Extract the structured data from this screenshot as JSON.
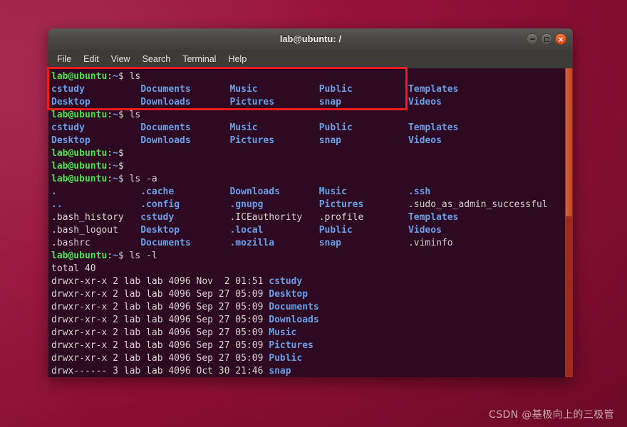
{
  "desktop": {
    "wallpaper_color": "#97113a",
    "watermark": "CSDN @基极向上的三极管"
  },
  "window": {
    "title": "lab@ubuntu: /",
    "controls": {
      "minimize_label": "–",
      "maximize_label": "□",
      "close_label": "×"
    },
    "menu": [
      {
        "label": "File"
      },
      {
        "label": "Edit"
      },
      {
        "label": "View"
      },
      {
        "label": "Search"
      },
      {
        "label": "Terminal"
      },
      {
        "label": "Help"
      }
    ]
  },
  "annotation": {
    "color": "#f01c1c",
    "encloses": "first ls command and its output"
  },
  "terminal": {
    "background_color": "#2d0922",
    "prompt": {
      "user_host": "lab@ubuntu",
      "separator": ":",
      "cwd": "~",
      "sigil": "$",
      "user_color": "#4ee04e",
      "cwd_color": "#6a9fe8",
      "text_color": "#d8d4d0",
      "dir_color": "#6a9fe8"
    },
    "scrollbar": {
      "track_color": "#a32a18",
      "thumb_color": "#c9552c"
    },
    "lines": [
      {
        "type": "prompt",
        "command": "ls"
      },
      {
        "type": "cols",
        "cells": [
          {
            "t": "cstudy",
            "c": "dir"
          },
          {
            "t": "Documents",
            "c": "dir"
          },
          {
            "t": "Music",
            "c": "dir"
          },
          {
            "t": "Public",
            "c": "dir"
          },
          {
            "t": "Templates",
            "c": "dir"
          }
        ]
      },
      {
        "type": "cols",
        "cells": [
          {
            "t": "Desktop",
            "c": "dir"
          },
          {
            "t": "Downloads",
            "c": "dir"
          },
          {
            "t": "Pictures",
            "c": "dir"
          },
          {
            "t": "snap",
            "c": "dir"
          },
          {
            "t": "Videos",
            "c": "dir"
          }
        ]
      },
      {
        "type": "prompt",
        "command": "ls"
      },
      {
        "type": "cols",
        "cells": [
          {
            "t": "cstudy",
            "c": "dir"
          },
          {
            "t": "Documents",
            "c": "dir"
          },
          {
            "t": "Music",
            "c": "dir"
          },
          {
            "t": "Public",
            "c": "dir"
          },
          {
            "t": "Templates",
            "c": "dir"
          }
        ]
      },
      {
        "type": "cols",
        "cells": [
          {
            "t": "Desktop",
            "c": "dir"
          },
          {
            "t": "Downloads",
            "c": "dir"
          },
          {
            "t": "Pictures",
            "c": "dir"
          },
          {
            "t": "snap",
            "c": "dir"
          },
          {
            "t": "Videos",
            "c": "dir"
          }
        ]
      },
      {
        "type": "prompt",
        "command": ""
      },
      {
        "type": "prompt",
        "command": ""
      },
      {
        "type": "prompt",
        "command": "ls -a"
      },
      {
        "type": "cols",
        "cells": [
          {
            "t": ".",
            "c": "dir"
          },
          {
            "t": ".cache",
            "c": "dir"
          },
          {
            "t": "Downloads",
            "c": "dir"
          },
          {
            "t": "Music",
            "c": "dir"
          },
          {
            "t": ".ssh",
            "c": "dir"
          }
        ]
      },
      {
        "type": "cols",
        "cells": [
          {
            "t": "..",
            "c": "dir"
          },
          {
            "t": ".config",
            "c": "dir"
          },
          {
            "t": ".gnupg",
            "c": "dir"
          },
          {
            "t": "Pictures",
            "c": "dir"
          },
          {
            "t": ".sudo_as_admin_successful",
            "c": "plain"
          }
        ]
      },
      {
        "type": "cols",
        "cells": [
          {
            "t": ".bash_history",
            "c": "plain"
          },
          {
            "t": "cstudy",
            "c": "dir"
          },
          {
            "t": ".ICEauthority",
            "c": "plain"
          },
          {
            "t": ".profile",
            "c": "plain"
          },
          {
            "t": "Templates",
            "c": "dir"
          }
        ]
      },
      {
        "type": "cols",
        "cells": [
          {
            "t": ".bash_logout",
            "c": "plain"
          },
          {
            "t": "Desktop",
            "c": "dir"
          },
          {
            "t": ".local",
            "c": "dir"
          },
          {
            "t": "Public",
            "c": "dir"
          },
          {
            "t": "Videos",
            "c": "dir"
          }
        ]
      },
      {
        "type": "cols",
        "cells": [
          {
            "t": ".bashrc",
            "c": "plain"
          },
          {
            "t": "Documents",
            "c": "dir"
          },
          {
            "t": ".mozilla",
            "c": "dir"
          },
          {
            "t": "snap",
            "c": "dir"
          },
          {
            "t": ".viminfo",
            "c": "plain"
          }
        ]
      },
      {
        "type": "prompt",
        "command": "ls -l"
      },
      {
        "type": "plain",
        "text": "total 40"
      },
      {
        "type": "longlist",
        "perms": "drwxr-xr-x",
        "links": "2",
        "owner": "lab",
        "group": "lab",
        "size": "4096",
        "month": "Nov",
        "day": " 2",
        "time": "01:51",
        "name": "cstudy"
      },
      {
        "type": "longlist",
        "perms": "drwxr-xr-x",
        "links": "2",
        "owner": "lab",
        "group": "lab",
        "size": "4096",
        "month": "Sep",
        "day": "27",
        "time": "05:09",
        "name": "Desktop"
      },
      {
        "type": "longlist",
        "perms": "drwxr-xr-x",
        "links": "2",
        "owner": "lab",
        "group": "lab",
        "size": "4096",
        "month": "Sep",
        "day": "27",
        "time": "05:09",
        "name": "Documents"
      },
      {
        "type": "longlist",
        "perms": "drwxr-xr-x",
        "links": "2",
        "owner": "lab",
        "group": "lab",
        "size": "4096",
        "month": "Sep",
        "day": "27",
        "time": "05:09",
        "name": "Downloads"
      },
      {
        "type": "longlist",
        "perms": "drwxr-xr-x",
        "links": "2",
        "owner": "lab",
        "group": "lab",
        "size": "4096",
        "month": "Sep",
        "day": "27",
        "time": "05:09",
        "name": "Music"
      },
      {
        "type": "longlist",
        "perms": "drwxr-xr-x",
        "links": "2",
        "owner": "lab",
        "group": "lab",
        "size": "4096",
        "month": "Sep",
        "day": "27",
        "time": "05:09",
        "name": "Pictures"
      },
      {
        "type": "longlist",
        "perms": "drwxr-xr-x",
        "links": "2",
        "owner": "lab",
        "group": "lab",
        "size": "4096",
        "month": "Sep",
        "day": "27",
        "time": "05:09",
        "name": "Public"
      },
      {
        "type": "longlist",
        "perms": "drwx------",
        "links": "3",
        "owner": "lab",
        "group": "lab",
        "size": "4096",
        "month": "Oct",
        "day": "30",
        "time": "21:46",
        "name": "snap"
      }
    ]
  }
}
